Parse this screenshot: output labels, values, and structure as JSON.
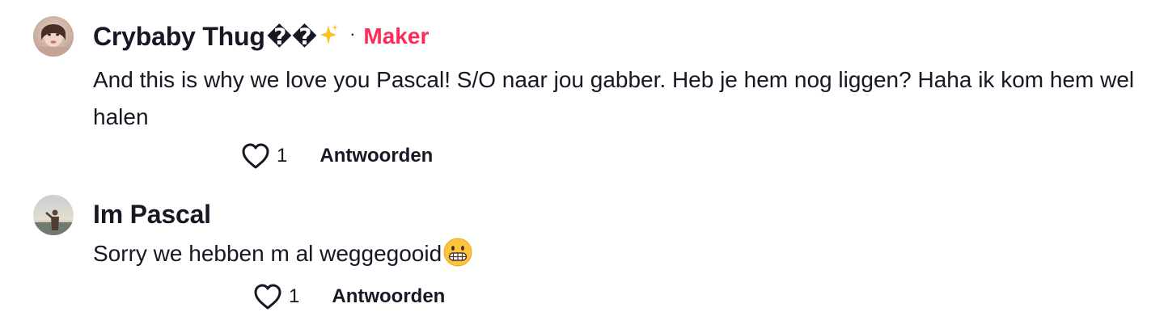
{
  "comments": [
    {
      "author": "Crybaby Thug",
      "author_suffix_glyphs": "��",
      "author_icon": "sparkles-icon",
      "separator": "·",
      "badge": "Maker",
      "badge_color": "#fe2c55",
      "text": "And this is why we love you Pascal! S/O naar jou gabber. Heb je hem nog liggen? Haha ik kom hem wel halen",
      "timestamp": "",
      "like_icon": "heart-outline-icon",
      "like_count": "1",
      "reply_label": "Antwoorden"
    },
    {
      "author": "Im Pascal",
      "text": "Sorry we hebben m al weggegooid",
      "text_emoji": "grimacing-face-emoji",
      "timestamp": "",
      "like_icon": "heart-outline-icon",
      "like_count": "1",
      "reply_label": "Antwoorden"
    }
  ],
  "colors": {
    "text": "#161823",
    "accent": "#fe2c55",
    "background": "#ffffff"
  }
}
